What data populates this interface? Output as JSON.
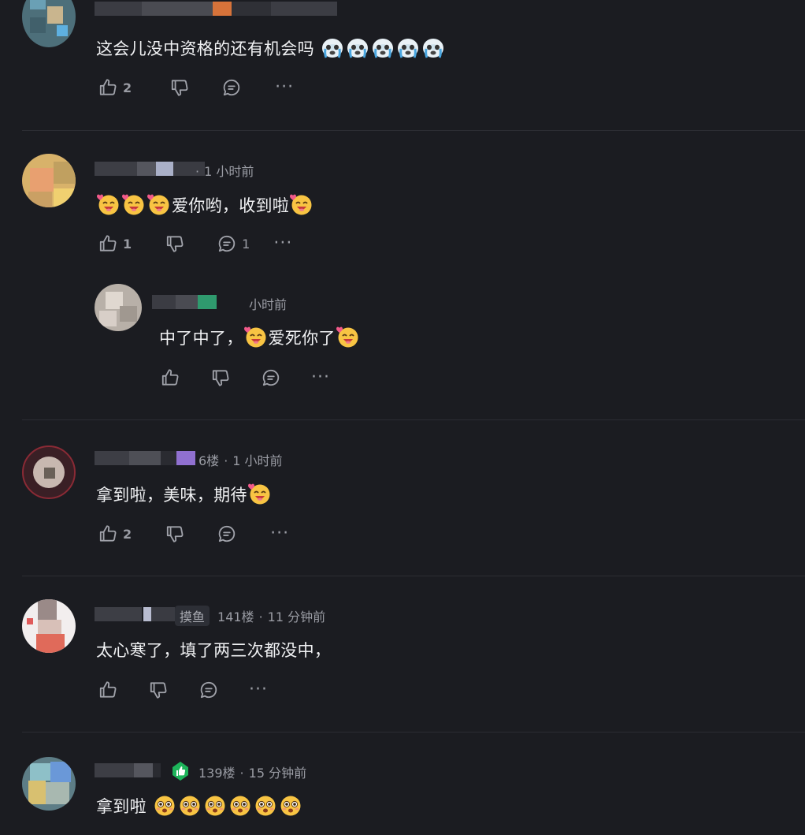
{
  "comments": [
    {
      "text": "这会儿没中资格的还有机会吗",
      "emoji": "crying-face",
      "emoji_count": 5,
      "meta": "",
      "likes": "2",
      "replies": ""
    },
    {
      "text": "爱你哟，收到啦",
      "emoji": "smiling-face-with-hearts",
      "meta": "1 小时前",
      "likes": "1",
      "replies": "1"
    },
    {
      "text": "中了中了，",
      "text2": "爱死你了",
      "emoji": "smiling-face-with-hearts",
      "meta": "小时前",
      "likes": "",
      "replies": ""
    },
    {
      "text": "拿到啦，美味，期待",
      "emoji": "smiling-face-with-hearts",
      "floor": "6楼",
      "meta": "1 小时前",
      "likes": "2",
      "replies": ""
    },
    {
      "text": "太心寒了，填了两三次都没中，",
      "tag": "摸鱼",
      "floor": "141楼",
      "meta": "11 分钟前",
      "likes": "",
      "replies": ""
    },
    {
      "text": "拿到啦",
      "emoji": "flushed-face",
      "emoji_count": 6,
      "floor": "139楼",
      "meta": "15 分钟前",
      "likes": "",
      "replies": ""
    }
  ],
  "colors": {
    "background": "#1b1c21",
    "text": "#f0f1f3",
    "muted": "#9a9ca4",
    "divider": "#2c2d33",
    "badge_green": "#1db45a"
  },
  "icons": [
    "thumbs-up-icon",
    "thumbs-down-icon",
    "reply-icon",
    "more-icon",
    "verified-badge-icon"
  ]
}
